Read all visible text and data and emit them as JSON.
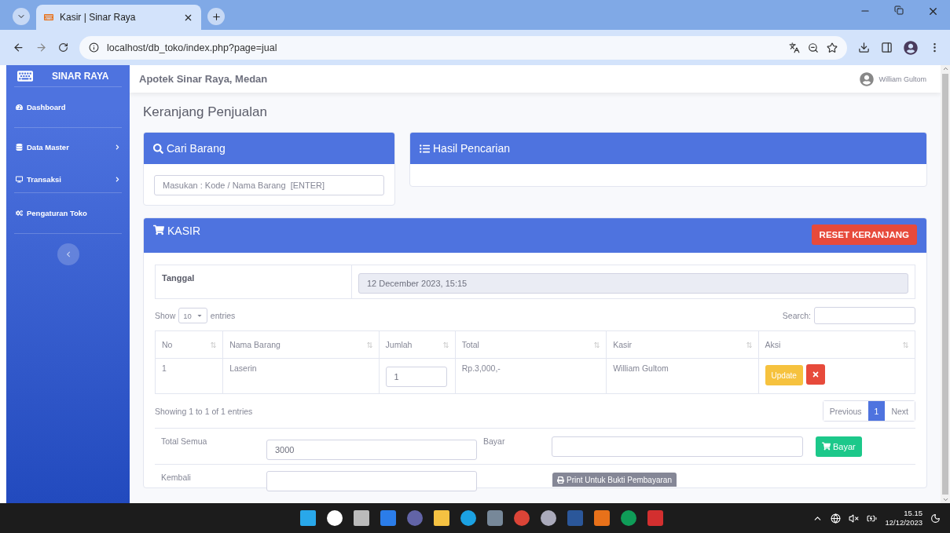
{
  "browser": {
    "tab_title": "Kasir | Sinar Raya",
    "url": "localhost/db_toko/index.php?page=jual"
  },
  "app": {
    "brand": "SINAR RAYA",
    "header_title": "Apotek Sinar Raya, Medan",
    "user_name": "William Gultom"
  },
  "sidebar": {
    "items": [
      {
        "kind": "dashboard",
        "label": "Dashboard",
        "expandable": false
      },
      {
        "kind": "database",
        "label": "Data Master",
        "expandable": true
      },
      {
        "kind": "desktop",
        "label": "Transaksi",
        "expandable": true
      },
      {
        "kind": "settings",
        "label": "Pengaturan Toko",
        "expandable": false
      }
    ]
  },
  "page_title": "Keranjang Penjualan",
  "search_card": {
    "title": "Cari Barang",
    "placeholder": "Masukan : Kode / Nama Barang  [ENTER]"
  },
  "results_card": {
    "title": "Hasil Pencarian"
  },
  "kasir": {
    "title": "KASIR",
    "reset_button": "RESET KERANJANG",
    "date_label": "Tanggal",
    "date_value": "12 December 2023, 15:15",
    "show_label": "Show",
    "page_length": "10",
    "entries_label": "entries",
    "search_label": "Search:",
    "columns": [
      "No",
      "Nama Barang",
      "Jumlah",
      "Total",
      "Kasir",
      "Aksi"
    ],
    "rows": [
      {
        "no": "1",
        "name": "Laserin",
        "qty": "1",
        "total": "Rp.3,000,-",
        "cashier": "William Gultom",
        "update_button": "Update"
      }
    ],
    "info": "Showing 1 to 1 of 1 entries",
    "pagination": [
      {
        "label": "Previous",
        "selected": false
      },
      {
        "label": "1",
        "selected": true
      },
      {
        "label": "Next",
        "selected": false
      }
    ],
    "total_label": "Total Semua",
    "total_value": "3000",
    "pay_label": "Bayar",
    "pay_button": "Bayar",
    "change_label": "Kembali",
    "print_button": "Print Untuk Bukti Pembayaran"
  },
  "taskbar": {
    "time": "15.15",
    "date": "12/12/2023"
  }
}
